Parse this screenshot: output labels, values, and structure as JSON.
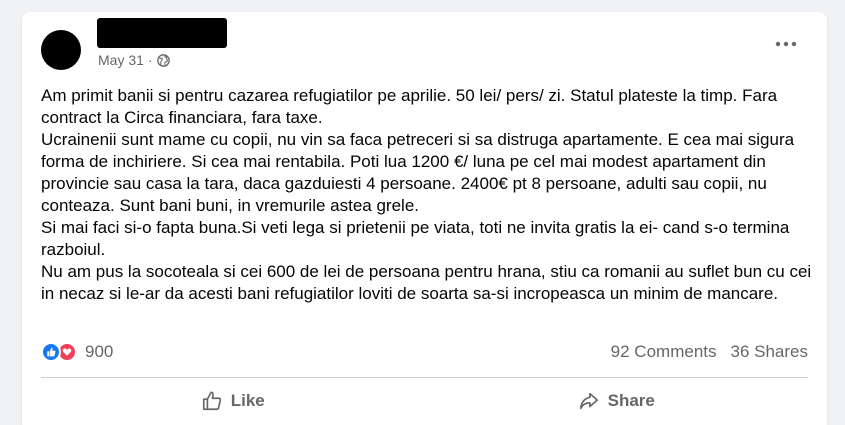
{
  "post": {
    "author_name": "",
    "date": "May 31",
    "separator": "·",
    "paragraphs": [
      "Am primit banii si pentru cazarea refugiatilor pe aprilie. 50 lei/ pers/ zi. Statul plateste la timp. Fara contract la Circa financiara, fara taxe.",
      "Ucrainenii sunt mame cu copii, nu vin sa faca petreceri si sa distruga apartamente. E cea mai sigura forma de inchiriere. Si cea mai rentabila. Poti lua 1200 €/ luna pe cel mai modest apartament din provincie sau casa la tara, daca gazduiesti 4 persoane. 2400€ pt 8 persoane, adulti sau copii, nu conteaza. Sunt bani buni, in vremurile astea grele.",
      "Si mai faci si-o fapta buna.Si veti lega si prietenii pe viata, toti ne invita gratis la ei- cand s-o termina razboiul.",
      "Nu am pus la socoteala si cei 600 de lei de persoana pentru hrana, stiu ca romanii au suflet bun cu cei in necaz si le-ar da acesti bani refugiatilor loviti de soarta sa-si incropeasca un minim de mancare."
    ]
  },
  "reactions": {
    "count": "900",
    "icons": [
      "like-icon",
      "love-icon"
    ]
  },
  "stats": {
    "comments": "92 Comments",
    "shares": "36 Shares"
  },
  "actions": {
    "like_label": "Like",
    "share_label": "Share"
  },
  "colors": {
    "background": "#f0f2f5",
    "card": "#ffffff",
    "text": "#050505",
    "secondary": "#65676b",
    "like_blue": "#1877f2",
    "love_red": "#f33e58"
  }
}
